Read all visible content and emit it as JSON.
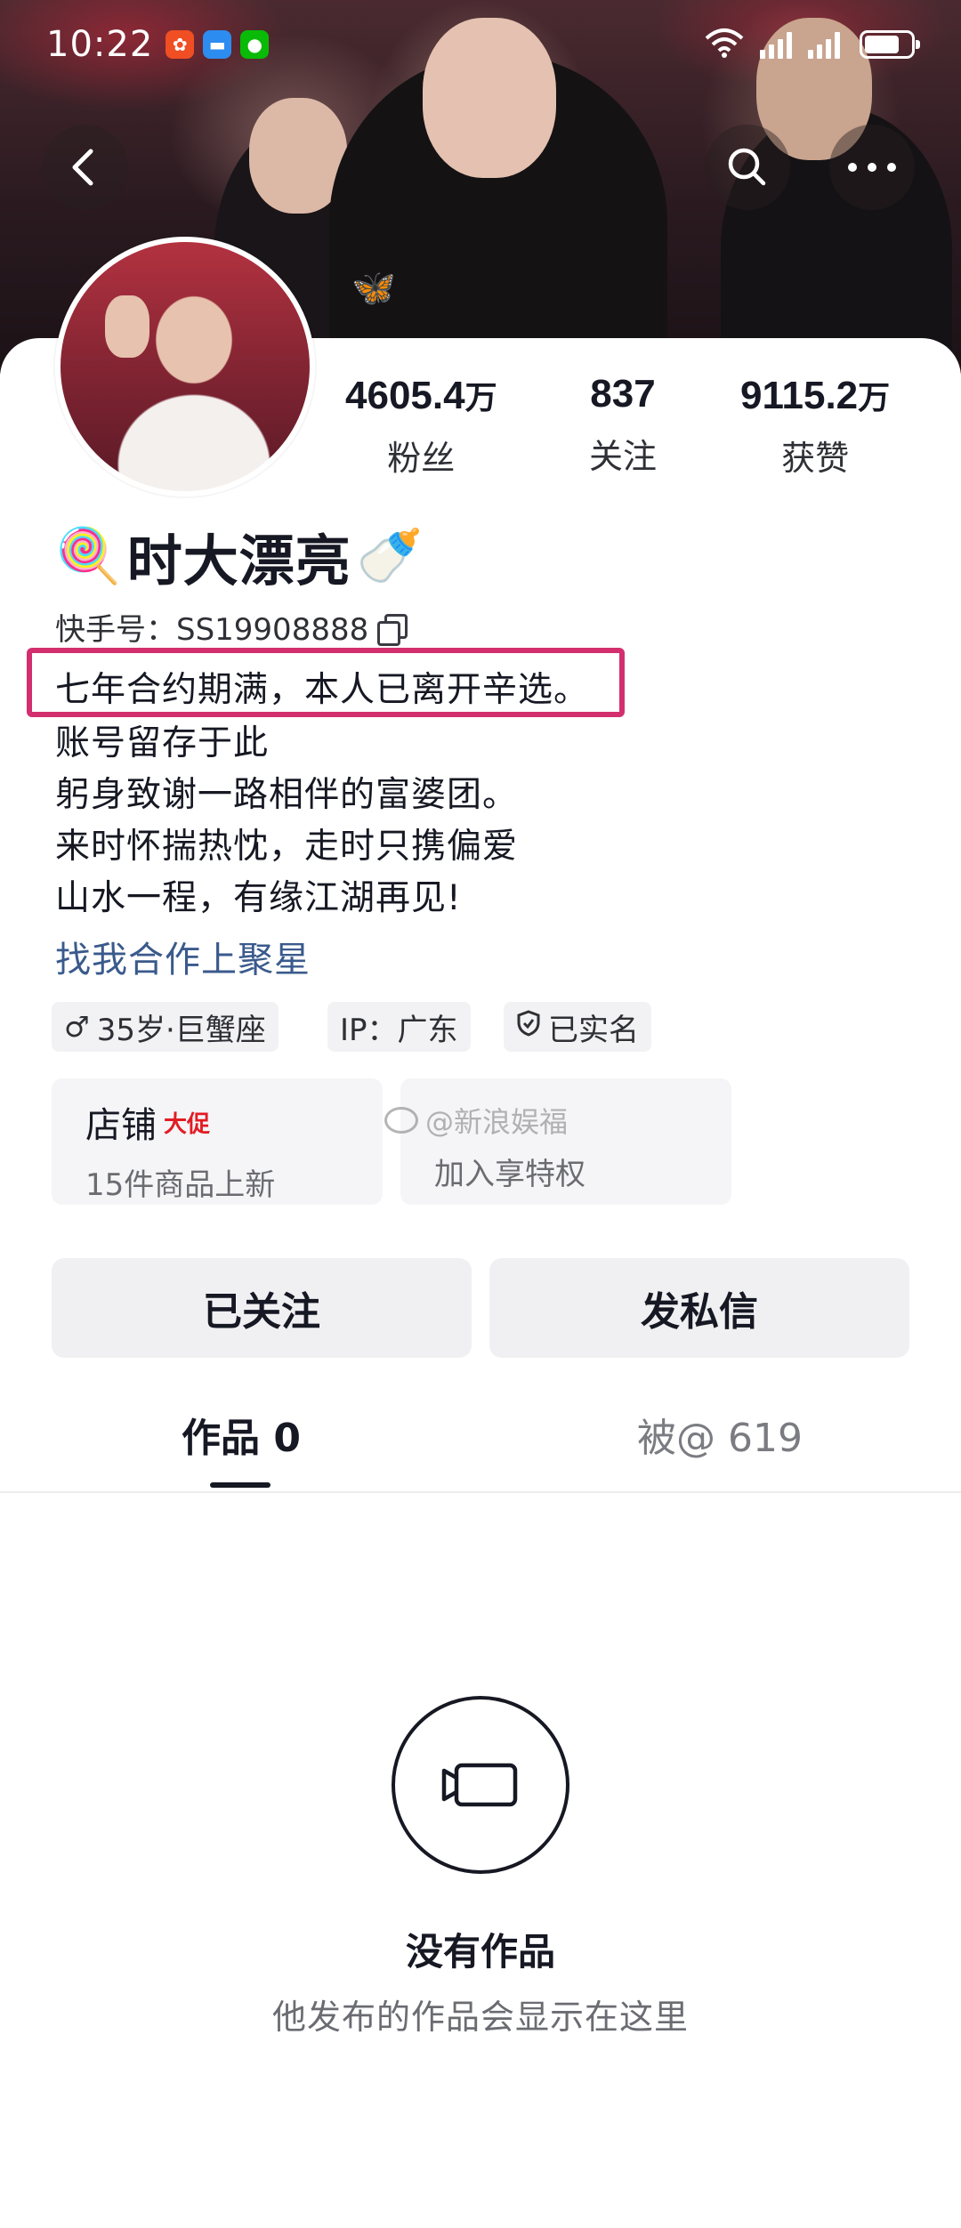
{
  "status_bar": {
    "time": "10:22"
  },
  "stats": [
    {
      "num": "4605.4",
      "unit": "万",
      "label": "粉丝"
    },
    {
      "num": "837",
      "unit": "",
      "label": "关注"
    },
    {
      "num": "9115.2",
      "unit": "万",
      "label": "获赞"
    }
  ],
  "profile": {
    "emoji_left": "🍭",
    "name": "时大漂亮",
    "emoji_right": "🍼",
    "kuaishou_id": "快手号：SS19908888"
  },
  "bio": {
    "line1": "七年合约期满，本人已离开辛选。",
    "line2": "账号留存于此",
    "line3": "躬身致谢一路相伴的富婆团。",
    "line4": "来时怀揣热忱，走时只携偏爱",
    "line5": "山水一程，有缘江湖再见!",
    "link": "找我合作上聚星"
  },
  "tags": {
    "age": "35岁·巨蟹座",
    "ip": "IP：广东",
    "verified": "已实名"
  },
  "tiles": {
    "shop_title": "店铺",
    "shop_promo": "大促",
    "shop_sub": "15件商品上新",
    "fans_sub": "加入享特权"
  },
  "watermark": "@新浪娱福",
  "buttons": {
    "following": "已关注",
    "message": "发私信"
  },
  "tabs": {
    "works": "作品 0",
    "mentions": "被@ 619"
  },
  "empty": {
    "title": "没有作品",
    "subtitle": "他发布的作品会显示在这里"
  }
}
